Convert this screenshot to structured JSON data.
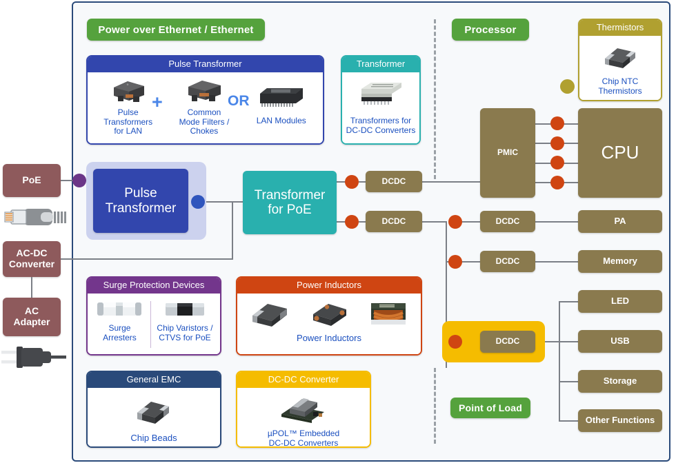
{
  "diagram": {
    "title": "PoE powered device power-tree block diagram",
    "colors": {
      "green_pill": "#55a23d",
      "blue_header": "#3246ad",
      "teal_header": "#29b0ae",
      "olive_header": "#b0a030",
      "purple_header": "#73368c",
      "orange_header": "#cf4512",
      "navy_header": "#2a4a7a",
      "yellow_header": "#f5bc00",
      "gold_block": "#8a7a4e",
      "source_block": "#8e5a5c",
      "node_red": "#cf4512",
      "node_purple": "#6b3687",
      "node_blue": "#2f55bd",
      "node_olive": "#b0a030",
      "caption_text": "#1a4fbf",
      "wire": "#7b7f86"
    }
  },
  "sections": {
    "poe": {
      "label": "Power over Ethernet / Ethernet"
    },
    "processor": {
      "label": "Processor"
    },
    "point_of_load": {
      "label": "Point of Load"
    }
  },
  "panels": {
    "pulse_transformer": {
      "header": "Pulse Transformer",
      "header_color": "#3246ad",
      "items": [
        {
          "caption": "Pulse\nTransformers\nfor LAN",
          "icon": "smd-transformer-icon"
        },
        {
          "caption": "Common\nMode Filters /\nChokes",
          "icon": "smd-choke-icon"
        },
        {
          "caption": "LAN Modules",
          "icon": "lan-module-ic-icon"
        }
      ],
      "connectors": {
        "plus": "+",
        "or": "OR"
      }
    },
    "transformer": {
      "header": "Transformer",
      "header_color": "#29b0ae",
      "items": [
        {
          "caption": "Transformers for\nDC-DC Converters",
          "icon": "dcdc-transformer-icon"
        }
      ]
    },
    "thermistors": {
      "header": "Thermistors",
      "header_color": "#b0a030",
      "items": [
        {
          "caption": "Chip NTC\nThermistors",
          "icon": "chip-ntc-icon"
        }
      ]
    },
    "surge": {
      "header": "Surge Protection Devices",
      "header_color": "#73368c",
      "items": [
        {
          "caption": "Surge\nArresters",
          "icon": "surge-arrester-icon"
        },
        {
          "caption": "Chip Varistors /\nCTVS for PoE",
          "icon": "chip-varistor-icon"
        }
      ]
    },
    "power_inductors": {
      "header": "Power Inductors",
      "header_color": "#cf4512",
      "items": [
        {
          "caption": "Power Inductors",
          "icon": "power-inductor-icon"
        }
      ]
    },
    "general_emc": {
      "header": "General EMC",
      "header_color": "#2a4a7a",
      "items": [
        {
          "caption": "Chip Beads",
          "icon": "chip-bead-icon"
        }
      ]
    },
    "dcdc_converter": {
      "header": "DC-DC Converter",
      "header_color": "#f5bc00",
      "items": [
        {
          "caption": "µPOL™ Embedded\nDC-DC Converters",
          "icon": "upol-module-icon"
        }
      ]
    }
  },
  "blocks": {
    "poe_source": {
      "label": "PoE"
    },
    "acdc": {
      "label": "AC-DC\nConverter"
    },
    "ac_adapter": {
      "label": "AC\nAdapter"
    },
    "pulse_xfmr": {
      "label": "Pulse\nTransformer"
    },
    "xfmr_poe": {
      "label": "Transformer\nfor PoE"
    },
    "dcdc_1": {
      "label": "DCDC"
    },
    "dcdc_2": {
      "label": "DCDC"
    },
    "dcdc_pa": {
      "label": "DCDC"
    },
    "dcdc_mem": {
      "label": "DCDC"
    },
    "dcdc_pol": {
      "label": "DCDC"
    },
    "pmic": {
      "label": "PMIC"
    },
    "cpu": {
      "label": "CPU"
    },
    "pa": {
      "label": "PA"
    },
    "memory": {
      "label": "Memory"
    },
    "led": {
      "label": "LED"
    },
    "usb": {
      "label": "USB"
    },
    "storage": {
      "label": "Storage"
    },
    "other": {
      "label": "Other Functions"
    }
  },
  "icons": {
    "rj45": "rj45-ethernet-connector-icon",
    "ac_plug": "ac-power-plug-icon"
  }
}
